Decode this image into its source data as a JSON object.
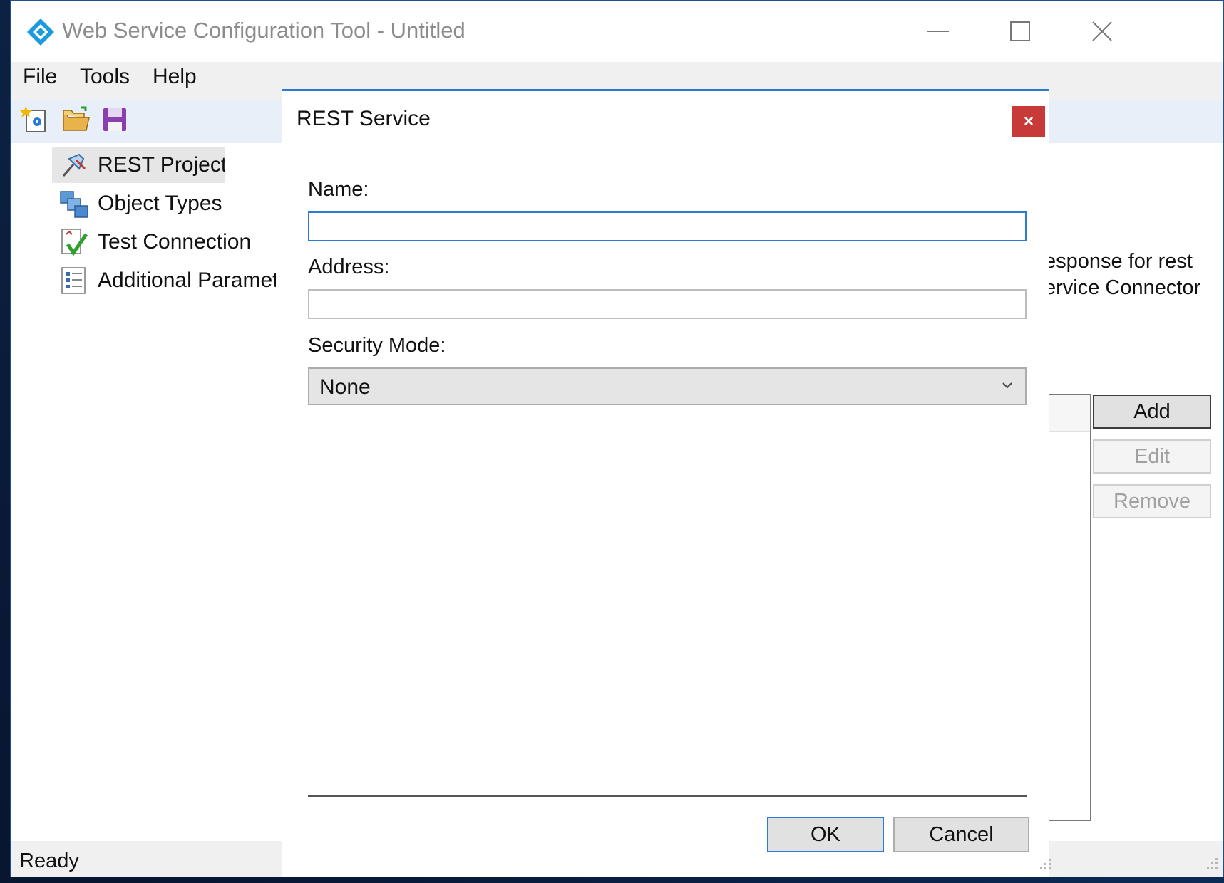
{
  "window": {
    "title": "Web Service Configuration Tool - Untitled",
    "icon": "app-diamond-icon"
  },
  "menu": [
    {
      "label": "File"
    },
    {
      "label": "Tools"
    },
    {
      "label": "Help"
    }
  ],
  "toolbar": {
    "buttons": [
      "new-project-icon",
      "open-folder-icon",
      "save-disk-icon"
    ]
  },
  "tree": {
    "items": [
      {
        "label": "REST Project",
        "icon": "rest-project-icon",
        "selected": true
      },
      {
        "label": "Object Types",
        "icon": "object-types-icon"
      },
      {
        "label": "Test Connection",
        "icon": "test-connection-icon"
      },
      {
        "label": "Additional Paramet",
        "icon": "additional-parameters-icon"
      }
    ]
  },
  "background_panel": {
    "description_line1": "esponse for rest",
    "description_line2": "ervice Connector",
    "buttons": [
      {
        "label": "Add",
        "enabled": true
      },
      {
        "label": "Edit",
        "enabled": false
      },
      {
        "label": "Remove",
        "enabled": false
      }
    ]
  },
  "status": {
    "text": "Ready"
  },
  "dialog": {
    "title": "REST Service",
    "close_label": "×",
    "name_label": "Name:",
    "name_value": "",
    "address_label": "Address:",
    "address_value": "",
    "security_mode_label": "Security Mode:",
    "security_mode_value": "None",
    "ok_label": "OK",
    "cancel_label": "Cancel"
  },
  "colors": {
    "accent_blue": "#2a7bd6",
    "close_red": "#c83a3a",
    "toolbar_bg": "#e9eff8",
    "desktop": "#0a1a36"
  }
}
